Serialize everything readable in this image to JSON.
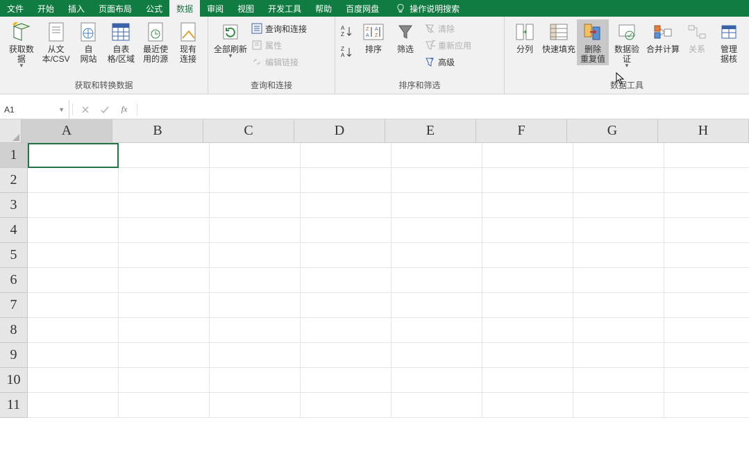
{
  "menu": {
    "items": [
      "文件",
      "开始",
      "插入",
      "页面布局",
      "公式",
      "数据",
      "审阅",
      "视图",
      "开发工具",
      "帮助",
      "百度网盘"
    ],
    "active_index": 5,
    "search_hint": "操作说明搜索"
  },
  "ribbon": {
    "groups": [
      {
        "label": "获取和转换数据",
        "buttons": [
          {
            "label": "获取数\n据",
            "dropdown": true
          },
          {
            "label": "从文\n本/CSV"
          },
          {
            "label": "自\n网站"
          },
          {
            "label": "自表\n格/区域"
          },
          {
            "label": "最近使\n用的源"
          },
          {
            "label": "现有\n连接"
          }
        ]
      },
      {
        "label": "查询和连接",
        "big": {
          "label": "全部刷新",
          "dropdown": true
        },
        "smalls": [
          {
            "label": "查询和连接"
          },
          {
            "label": "属性",
            "disabled": true
          },
          {
            "label": "编辑链接",
            "disabled": true
          }
        ]
      },
      {
        "label": "排序和筛选",
        "big_sort": {
          "label": "排序"
        },
        "big_filter": {
          "label": "筛选"
        },
        "smalls": [
          {
            "label": "清除",
            "disabled": true
          },
          {
            "label": "重新应用",
            "disabled": true
          },
          {
            "label": "高级"
          }
        ]
      },
      {
        "label": "数据工具",
        "buttons": [
          {
            "label": "分列"
          },
          {
            "label": "快速填充"
          },
          {
            "label": "删除\n重复值",
            "hovered": true
          },
          {
            "label": "数据验\n证",
            "dropdown": true
          },
          {
            "label": "合并计算"
          },
          {
            "label": "关系",
            "disabled": true
          },
          {
            "label": "管理\n据核"
          }
        ]
      }
    ]
  },
  "formula_bar": {
    "name_box": "A1",
    "formula": ""
  },
  "sheet": {
    "columns": [
      "A",
      "B",
      "C",
      "D",
      "E",
      "F",
      "G",
      "H"
    ],
    "rows": [
      "1",
      "2",
      "3",
      "4",
      "5",
      "6",
      "7",
      "8",
      "9",
      "10",
      "11"
    ],
    "active_cell": {
      "row": 0,
      "col": 0
    }
  }
}
